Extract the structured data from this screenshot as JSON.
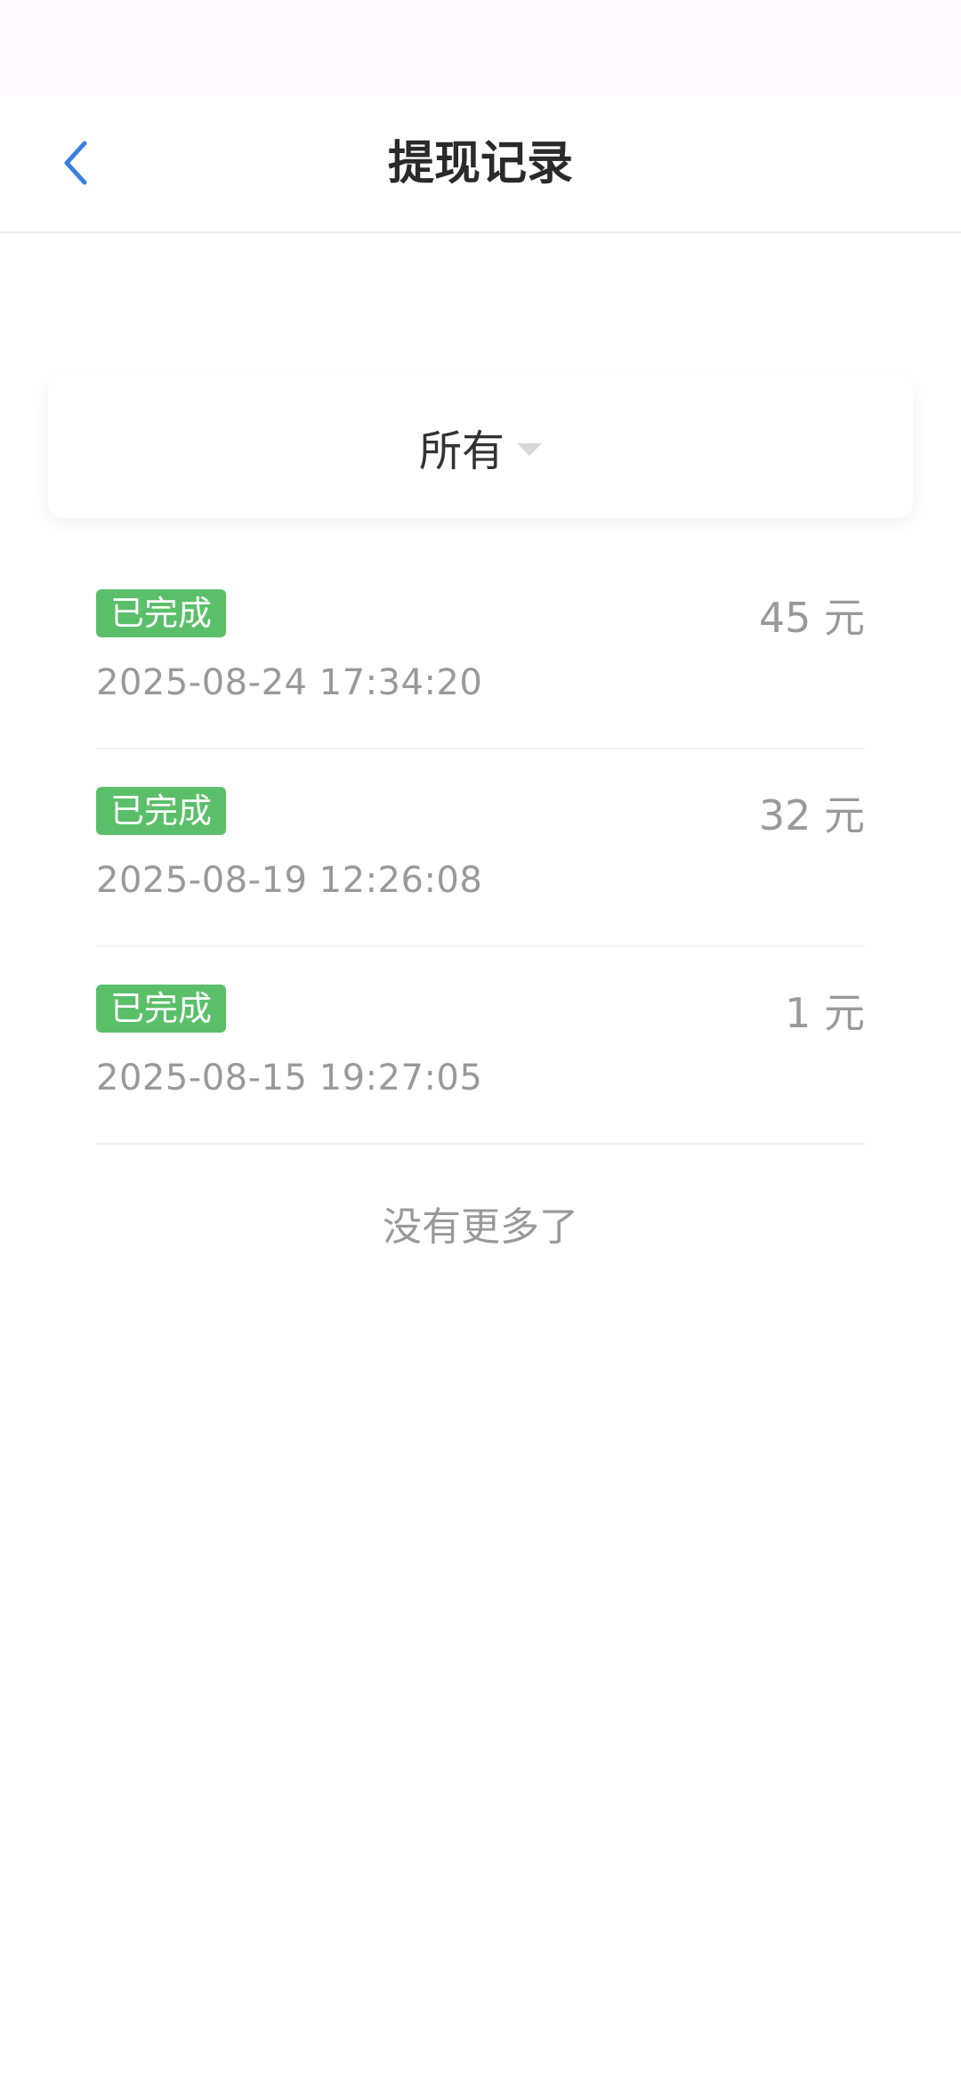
{
  "header": {
    "title": "提现记录",
    "back_icon": "chevron-left-icon"
  },
  "colors": {
    "accent": "#3a7ee0",
    "status_completed": "#5bbf6a"
  },
  "filter": {
    "selected": "所有"
  },
  "records": [
    {
      "status": "已完成",
      "amount": "45 元",
      "time": "2025-08-24 17:34:20"
    },
    {
      "status": "已完成",
      "amount": "32 元",
      "time": "2025-08-19 12:26:08"
    },
    {
      "status": "已完成",
      "amount": "1 元",
      "time": "2025-08-15 19:27:05"
    }
  ],
  "footer": {
    "no_more": "没有更多了"
  }
}
